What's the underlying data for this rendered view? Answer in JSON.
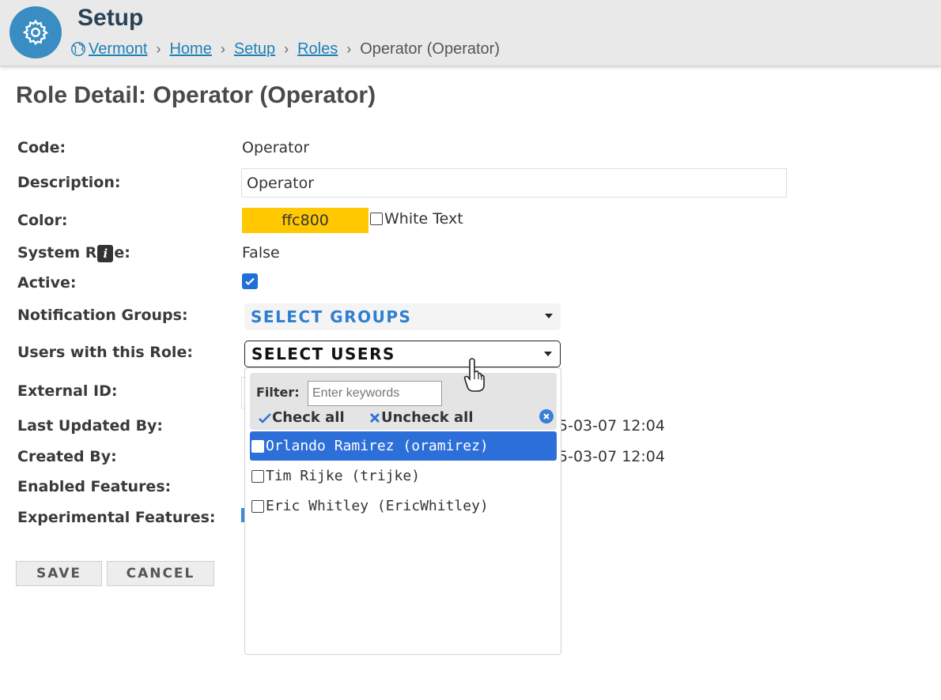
{
  "header": {
    "title": "Setup",
    "breadcrumb": {
      "vermont": "Vermont",
      "home": "Home",
      "setup": "Setup",
      "roles": "Roles",
      "current": "Operator (Operator)",
      "separator": "›"
    },
    "icon_bg": "#3a8dc2"
  },
  "page": {
    "title": "Role Detail: Operator (Operator)"
  },
  "form": {
    "code_label": "Code:",
    "code_value": "Operator",
    "description_label": "Description:",
    "description_value": "Operator",
    "color_label": "Color:",
    "color_value": "ffc800",
    "color_swatch": "#ffc800",
    "white_text_label": "White Text",
    "system_role_label_a": "System R",
    "system_role_label_b": "e:",
    "system_role_info": "i",
    "system_role_value": "False",
    "active_label": "Active:",
    "active_checked": true,
    "notification_groups_label": "Notification Groups:",
    "notification_groups_select": "SELECT GROUPS",
    "users_label": "Users with this Role:",
    "users_select": "SELECT USERS",
    "external_id_label": "External ID:",
    "last_updated_label": "Last Updated By:",
    "last_updated_partial": "5-03-07 12:04",
    "created_by_label": "Created By:",
    "created_by_partial": "5-03-07 12:04",
    "enabled_features_label": "Enabled Features:",
    "experimental_features_label": "Experimental Features:"
  },
  "popup": {
    "filter_label": "Filter:",
    "filter_placeholder": "Enter keywords",
    "check_all": "Check all",
    "uncheck_all": "Uncheck all",
    "users": [
      {
        "label": "Orlando Ramirez (oramirez)",
        "selected": true
      },
      {
        "label": "Tim Rijke (trijke)",
        "selected": false
      },
      {
        "label": "Eric Whitley (EricWhitley)",
        "selected": false
      }
    ]
  },
  "buttons": {
    "save": "SAVE",
    "cancel": "CANCEL"
  }
}
